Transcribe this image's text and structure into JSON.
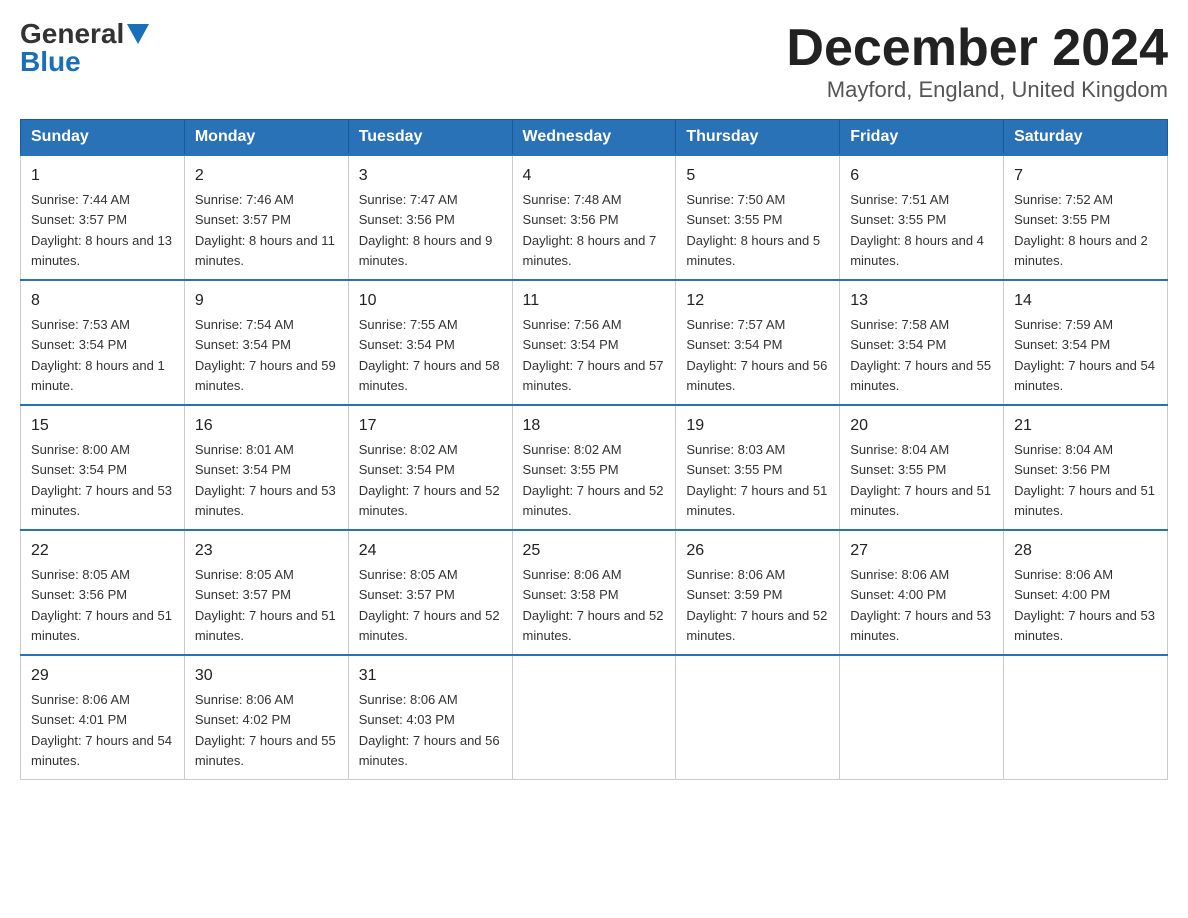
{
  "header": {
    "logo_general": "General",
    "logo_blue": "Blue",
    "month_title": "December 2024",
    "location": "Mayford, England, United Kingdom"
  },
  "days_of_week": [
    "Sunday",
    "Monday",
    "Tuesday",
    "Wednesday",
    "Thursday",
    "Friday",
    "Saturday"
  ],
  "weeks": [
    [
      {
        "num": "1",
        "sunrise": "7:44 AM",
        "sunset": "3:57 PM",
        "daylight": "8 hours and 13 minutes."
      },
      {
        "num": "2",
        "sunrise": "7:46 AM",
        "sunset": "3:57 PM",
        "daylight": "8 hours and 11 minutes."
      },
      {
        "num": "3",
        "sunrise": "7:47 AM",
        "sunset": "3:56 PM",
        "daylight": "8 hours and 9 minutes."
      },
      {
        "num": "4",
        "sunrise": "7:48 AM",
        "sunset": "3:56 PM",
        "daylight": "8 hours and 7 minutes."
      },
      {
        "num": "5",
        "sunrise": "7:50 AM",
        "sunset": "3:55 PM",
        "daylight": "8 hours and 5 minutes."
      },
      {
        "num": "6",
        "sunrise": "7:51 AM",
        "sunset": "3:55 PM",
        "daylight": "8 hours and 4 minutes."
      },
      {
        "num": "7",
        "sunrise": "7:52 AM",
        "sunset": "3:55 PM",
        "daylight": "8 hours and 2 minutes."
      }
    ],
    [
      {
        "num": "8",
        "sunrise": "7:53 AM",
        "sunset": "3:54 PM",
        "daylight": "8 hours and 1 minute."
      },
      {
        "num": "9",
        "sunrise": "7:54 AM",
        "sunset": "3:54 PM",
        "daylight": "7 hours and 59 minutes."
      },
      {
        "num": "10",
        "sunrise": "7:55 AM",
        "sunset": "3:54 PM",
        "daylight": "7 hours and 58 minutes."
      },
      {
        "num": "11",
        "sunrise": "7:56 AM",
        "sunset": "3:54 PM",
        "daylight": "7 hours and 57 minutes."
      },
      {
        "num": "12",
        "sunrise": "7:57 AM",
        "sunset": "3:54 PM",
        "daylight": "7 hours and 56 minutes."
      },
      {
        "num": "13",
        "sunrise": "7:58 AM",
        "sunset": "3:54 PM",
        "daylight": "7 hours and 55 minutes."
      },
      {
        "num": "14",
        "sunrise": "7:59 AM",
        "sunset": "3:54 PM",
        "daylight": "7 hours and 54 minutes."
      }
    ],
    [
      {
        "num": "15",
        "sunrise": "8:00 AM",
        "sunset": "3:54 PM",
        "daylight": "7 hours and 53 minutes."
      },
      {
        "num": "16",
        "sunrise": "8:01 AM",
        "sunset": "3:54 PM",
        "daylight": "7 hours and 53 minutes."
      },
      {
        "num": "17",
        "sunrise": "8:02 AM",
        "sunset": "3:54 PM",
        "daylight": "7 hours and 52 minutes."
      },
      {
        "num": "18",
        "sunrise": "8:02 AM",
        "sunset": "3:55 PM",
        "daylight": "7 hours and 52 minutes."
      },
      {
        "num": "19",
        "sunrise": "8:03 AM",
        "sunset": "3:55 PM",
        "daylight": "7 hours and 51 minutes."
      },
      {
        "num": "20",
        "sunrise": "8:04 AM",
        "sunset": "3:55 PM",
        "daylight": "7 hours and 51 minutes."
      },
      {
        "num": "21",
        "sunrise": "8:04 AM",
        "sunset": "3:56 PM",
        "daylight": "7 hours and 51 minutes."
      }
    ],
    [
      {
        "num": "22",
        "sunrise": "8:05 AM",
        "sunset": "3:56 PM",
        "daylight": "7 hours and 51 minutes."
      },
      {
        "num": "23",
        "sunrise": "8:05 AM",
        "sunset": "3:57 PM",
        "daylight": "7 hours and 51 minutes."
      },
      {
        "num": "24",
        "sunrise": "8:05 AM",
        "sunset": "3:57 PM",
        "daylight": "7 hours and 52 minutes."
      },
      {
        "num": "25",
        "sunrise": "8:06 AM",
        "sunset": "3:58 PM",
        "daylight": "7 hours and 52 minutes."
      },
      {
        "num": "26",
        "sunrise": "8:06 AM",
        "sunset": "3:59 PM",
        "daylight": "7 hours and 52 minutes."
      },
      {
        "num": "27",
        "sunrise": "8:06 AM",
        "sunset": "4:00 PM",
        "daylight": "7 hours and 53 minutes."
      },
      {
        "num": "28",
        "sunrise": "8:06 AM",
        "sunset": "4:00 PM",
        "daylight": "7 hours and 53 minutes."
      }
    ],
    [
      {
        "num": "29",
        "sunrise": "8:06 AM",
        "sunset": "4:01 PM",
        "daylight": "7 hours and 54 minutes."
      },
      {
        "num": "30",
        "sunrise": "8:06 AM",
        "sunset": "4:02 PM",
        "daylight": "7 hours and 55 minutes."
      },
      {
        "num": "31",
        "sunrise": "8:06 AM",
        "sunset": "4:03 PM",
        "daylight": "7 hours and 56 minutes."
      },
      null,
      null,
      null,
      null
    ]
  ]
}
